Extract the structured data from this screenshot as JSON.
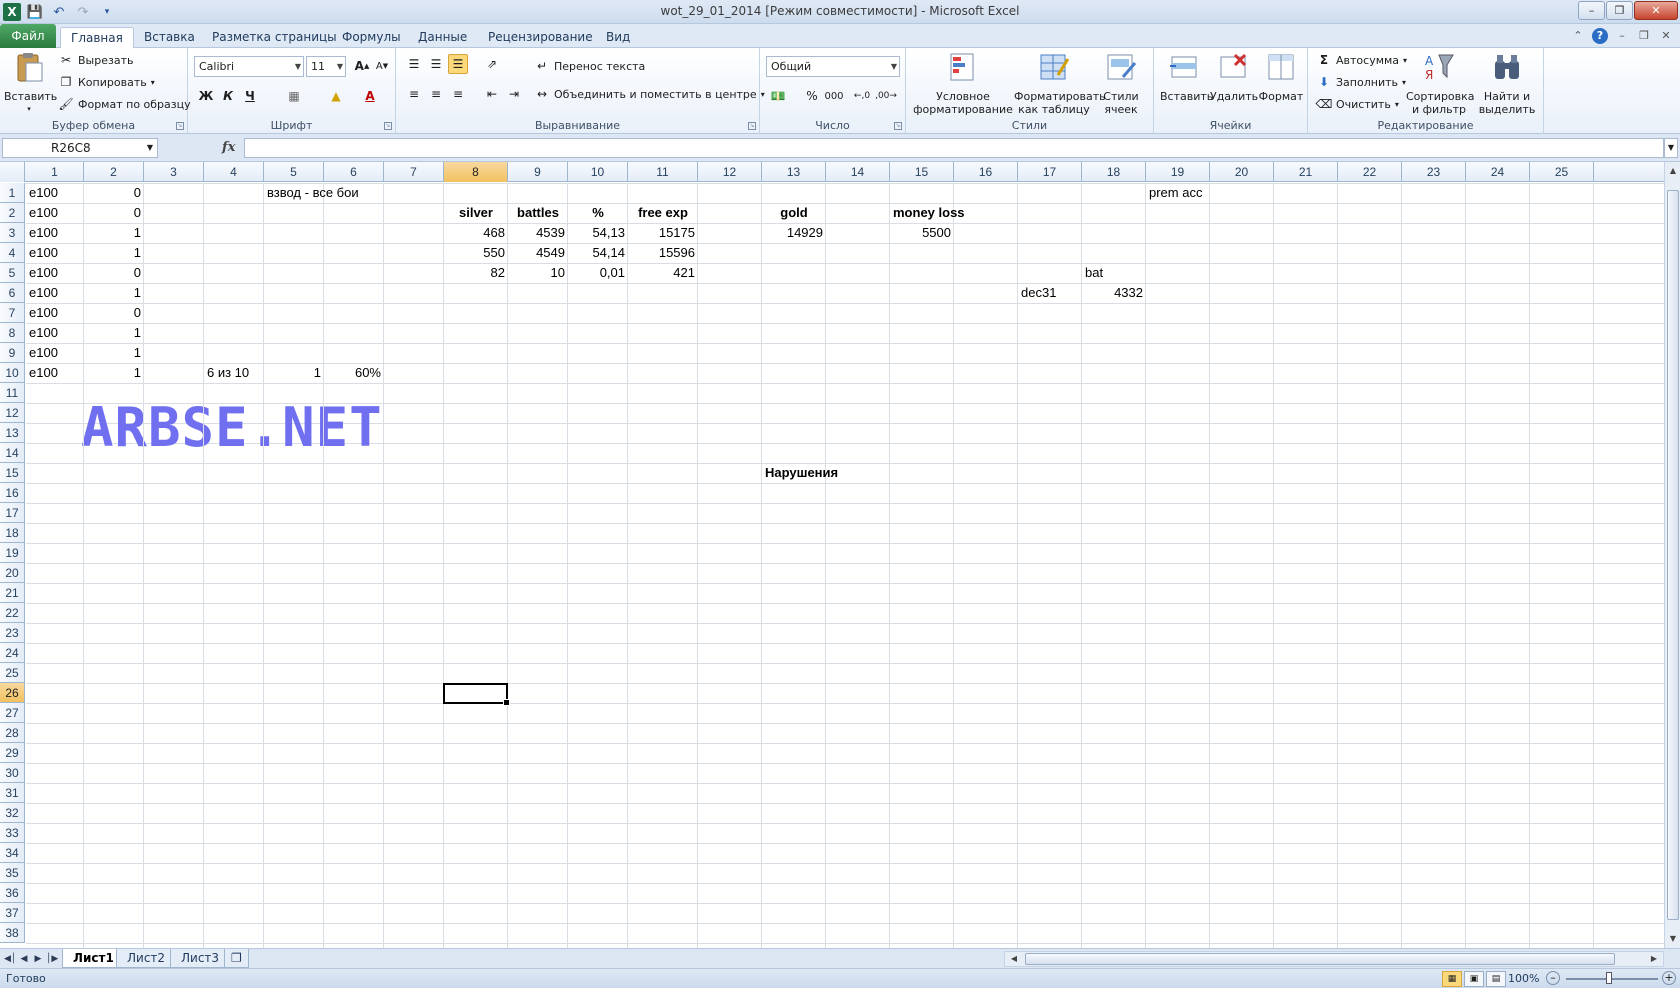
{
  "window": {
    "title": "wot_29_01_2014  [Режим совместимости]  -  Microsoft Excel",
    "logo": "X"
  },
  "tabs": [
    "Файл",
    "Главная",
    "Вставка",
    "Разметка страницы",
    "Формулы",
    "Данные",
    "Рецензирование",
    "Вид"
  ],
  "active_tab_index": 1,
  "ribbon": {
    "clipboard": {
      "label": "Буфер обмена",
      "paste": "Вставить",
      "cut": "Вырезать",
      "copy": "Копировать",
      "format_painter": "Формат по образцу"
    },
    "font": {
      "label": "Шрифт",
      "name": "Calibri",
      "size": "11",
      "bold": "Ж",
      "italic": "К",
      "underline": "Ч"
    },
    "alignment": {
      "label": "Выравнивание",
      "wrap": "Перенос текста",
      "merge": "Объединить и поместить в центре"
    },
    "number": {
      "label": "Число",
      "format": "Общий",
      "percent": "%",
      "thousands": "000"
    },
    "styles": {
      "label": "Стили",
      "conditional": "Условное форматирование",
      "as_table": "Форматировать как таблицу",
      "cell_styles": "Стили ячеек"
    },
    "cells": {
      "label": "Ячейки",
      "insert": "Вставить",
      "delete": "Удалить",
      "format": "Формат"
    },
    "editing": {
      "label": "Редактирование",
      "autosum": "Автосумма",
      "fill": "Заполнить",
      "clear": "Очистить",
      "sort": "Сортировка и фильтр",
      "find": "Найти и выделить"
    }
  },
  "formula_bar": {
    "name_box": "R26C8",
    "fx": "fx",
    "formula": ""
  },
  "grid": {
    "columns": [
      "1",
      "2",
      "3",
      "4",
      "5",
      "6",
      "7",
      "8",
      "9",
      "10",
      "11",
      "12",
      "13",
      "14",
      "15",
      "16",
      "17",
      "18",
      "19",
      "20",
      "21",
      "22",
      "23",
      "24",
      "25"
    ],
    "rows": [
      "1",
      "2",
      "3",
      "4",
      "5",
      "6",
      "7",
      "8",
      "9",
      "10",
      "11",
      "12",
      "13",
      "14",
      "15",
      "16",
      "17",
      "18",
      "19",
      "20",
      "21",
      "22",
      "23",
      "24",
      "25",
      "26",
      "27",
      "28",
      "29",
      "30",
      "31",
      "32",
      "33",
      "34",
      "35",
      "36",
      "37",
      "38"
    ],
    "active_cell": {
      "row": 26,
      "col": 8
    },
    "cells": [
      {
        "r": 1,
        "c": 1,
        "v": "e100"
      },
      {
        "r": 1,
        "c": 2,
        "v": "0",
        "n": true
      },
      {
        "r": 1,
        "c": 5,
        "v": "взвод - все бои"
      },
      {
        "r": 1,
        "c": 19,
        "v": "prem acc"
      },
      {
        "r": 2,
        "c": 1,
        "v": "e100"
      },
      {
        "r": 2,
        "c": 2,
        "v": "0",
        "n": true
      },
      {
        "r": 2,
        "c": 8,
        "v": "silver",
        "b": true,
        "ctr": true
      },
      {
        "r": 2,
        "c": 9,
        "v": "battles",
        "b": true,
        "ctr": true
      },
      {
        "r": 2,
        "c": 10,
        "v": "%",
        "b": true,
        "ctr": true
      },
      {
        "r": 2,
        "c": 11,
        "v": "free exp",
        "b": true,
        "ctr": true
      },
      {
        "r": 2,
        "c": 13,
        "v": "gold",
        "b": true,
        "ctr": true
      },
      {
        "r": 2,
        "c": 15,
        "v": "money loss",
        "b": true,
        "ctr": true
      },
      {
        "r": 3,
        "c": 1,
        "v": "e100"
      },
      {
        "r": 3,
        "c": 2,
        "v": "1",
        "n": true
      },
      {
        "r": 3,
        "c": 8,
        "v": "468",
        "n": true
      },
      {
        "r": 3,
        "c": 9,
        "v": "4539",
        "n": true
      },
      {
        "r": 3,
        "c": 10,
        "v": "54,13",
        "n": true
      },
      {
        "r": 3,
        "c": 11,
        "v": "15175",
        "n": true
      },
      {
        "r": 3,
        "c": 13,
        "v": "14929",
        "n": true
      },
      {
        "r": 3,
        "c": 15,
        "v": "5500",
        "n": true
      },
      {
        "r": 4,
        "c": 1,
        "v": "e100"
      },
      {
        "r": 4,
        "c": 2,
        "v": "1",
        "n": true
      },
      {
        "r": 4,
        "c": 8,
        "v": "550",
        "n": true
      },
      {
        "r": 4,
        "c": 9,
        "v": "4549",
        "n": true
      },
      {
        "r": 4,
        "c": 10,
        "v": "54,14",
        "n": true
      },
      {
        "r": 4,
        "c": 11,
        "v": "15596",
        "n": true
      },
      {
        "r": 5,
        "c": 1,
        "v": "e100"
      },
      {
        "r": 5,
        "c": 2,
        "v": "0",
        "n": true
      },
      {
        "r": 5,
        "c": 8,
        "v": "82",
        "n": true
      },
      {
        "r": 5,
        "c": 9,
        "v": "10",
        "n": true
      },
      {
        "r": 5,
        "c": 10,
        "v": "0,01",
        "n": true
      },
      {
        "r": 5,
        "c": 11,
        "v": "421",
        "n": true
      },
      {
        "r": 5,
        "c": 18,
        "v": "bat"
      },
      {
        "r": 6,
        "c": 1,
        "v": "e100"
      },
      {
        "r": 6,
        "c": 2,
        "v": "1",
        "n": true
      },
      {
        "r": 6,
        "c": 17,
        "v": "dec31"
      },
      {
        "r": 6,
        "c": 18,
        "v": "4332",
        "n": true
      },
      {
        "r": 7,
        "c": 1,
        "v": "e100"
      },
      {
        "r": 7,
        "c": 2,
        "v": "0",
        "n": true
      },
      {
        "r": 8,
        "c": 1,
        "v": "e100"
      },
      {
        "r": 8,
        "c": 2,
        "v": "1",
        "n": true
      },
      {
        "r": 9,
        "c": 1,
        "v": "e100"
      },
      {
        "r": 9,
        "c": 2,
        "v": "1",
        "n": true
      },
      {
        "r": 10,
        "c": 1,
        "v": "e100"
      },
      {
        "r": 10,
        "c": 2,
        "v": "1",
        "n": true
      },
      {
        "r": 10,
        "c": 4,
        "v": "6 из 10"
      },
      {
        "r": 10,
        "c": 5,
        "v": "1",
        "n": true
      },
      {
        "r": 10,
        "c": 6,
        "v": "60%",
        "n": true
      },
      {
        "r": 15,
        "c": 13,
        "v": "Нарушения",
        "b": true
      }
    ]
  },
  "watermark": "ARBSE.NET",
  "sheets": [
    "Лист1",
    "Лист2",
    "Лист3"
  ],
  "active_sheet_index": 0,
  "status": {
    "ready": "Готово",
    "zoom": "100%"
  }
}
